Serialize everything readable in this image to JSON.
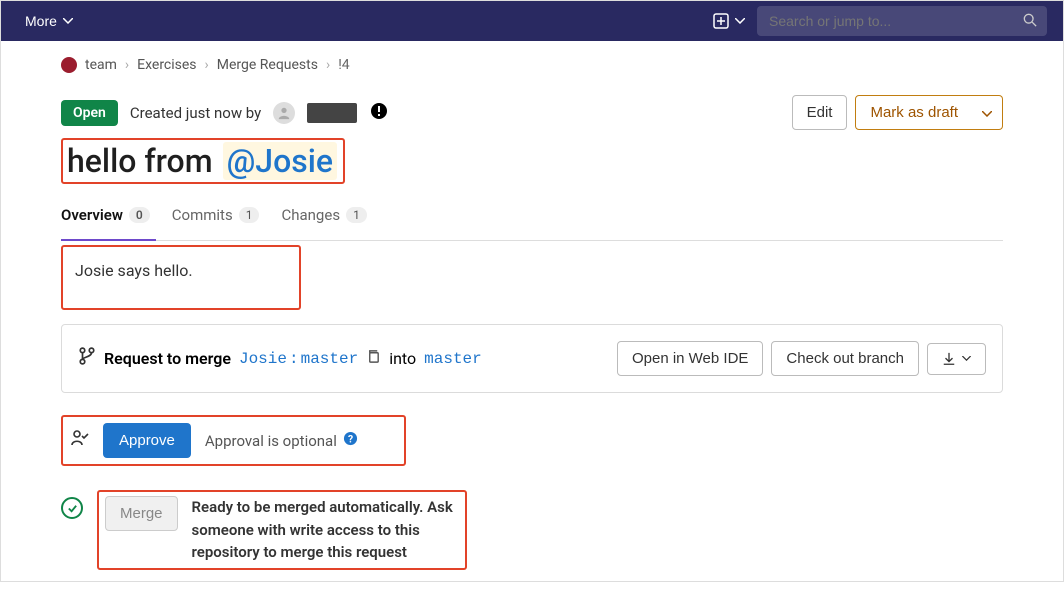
{
  "topbar": {
    "more": "More",
    "search_placeholder": "Search or jump to..."
  },
  "breadcrumb": {
    "team": "team",
    "exercises": "Exercises",
    "mr": "Merge Requests",
    "id": "!4"
  },
  "header": {
    "status": "Open",
    "created": "Created just now by",
    "edit": "Edit",
    "draft": "Mark as draft"
  },
  "title": {
    "prefix": "hello from",
    "mention": "@Josie"
  },
  "tabs": {
    "overview": "Overview",
    "overview_count": "0",
    "commits": "Commits",
    "commits_count": "1",
    "changes": "Changes",
    "changes_count": "1"
  },
  "description": "Josie says hello.",
  "merge_widget": {
    "label": "Request to merge",
    "source_user": "Josie",
    "sep": ":",
    "source_branch": "master",
    "into": "into",
    "target": "master",
    "open_ide": "Open in Web IDE",
    "checkout": "Check out branch"
  },
  "approval": {
    "button": "Approve",
    "text": "Approval is optional"
  },
  "merge": {
    "button": "Merge",
    "text": "Ready to be merged automatically. Ask someone with write access to this repository to merge this request"
  }
}
